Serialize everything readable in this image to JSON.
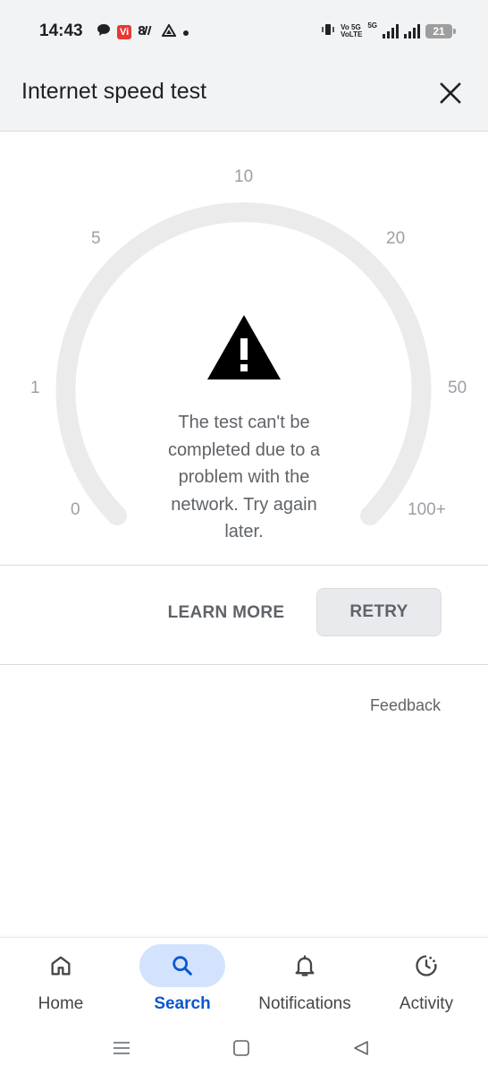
{
  "status_bar": {
    "time": "14:43",
    "carrier_badge": "Vi",
    "network_label_top": "Vo 5G",
    "network_label_bottom": "VoLTE",
    "network_type": "5G",
    "battery": "21"
  },
  "header": {
    "title": "Internet speed test"
  },
  "gauge": {
    "ticks": [
      "0",
      "1",
      "5",
      "10",
      "20",
      "50",
      "100+"
    ],
    "track_color": "#ebebeb"
  },
  "error": {
    "message": "The test can't be completed due to a problem with the network. Try again later."
  },
  "actions": {
    "learn_more": "LEARN MORE",
    "retry": "RETRY",
    "feedback": "Feedback"
  },
  "bottom_nav": {
    "items": [
      {
        "label": "Home",
        "icon": "home-icon",
        "active": false
      },
      {
        "label": "Search",
        "icon": "search-icon",
        "active": true
      },
      {
        "label": "Notifications",
        "icon": "bell-icon",
        "active": false
      },
      {
        "label": "Activity",
        "icon": "activity-icon",
        "active": false
      }
    ],
    "accent": "#0b57d0"
  }
}
